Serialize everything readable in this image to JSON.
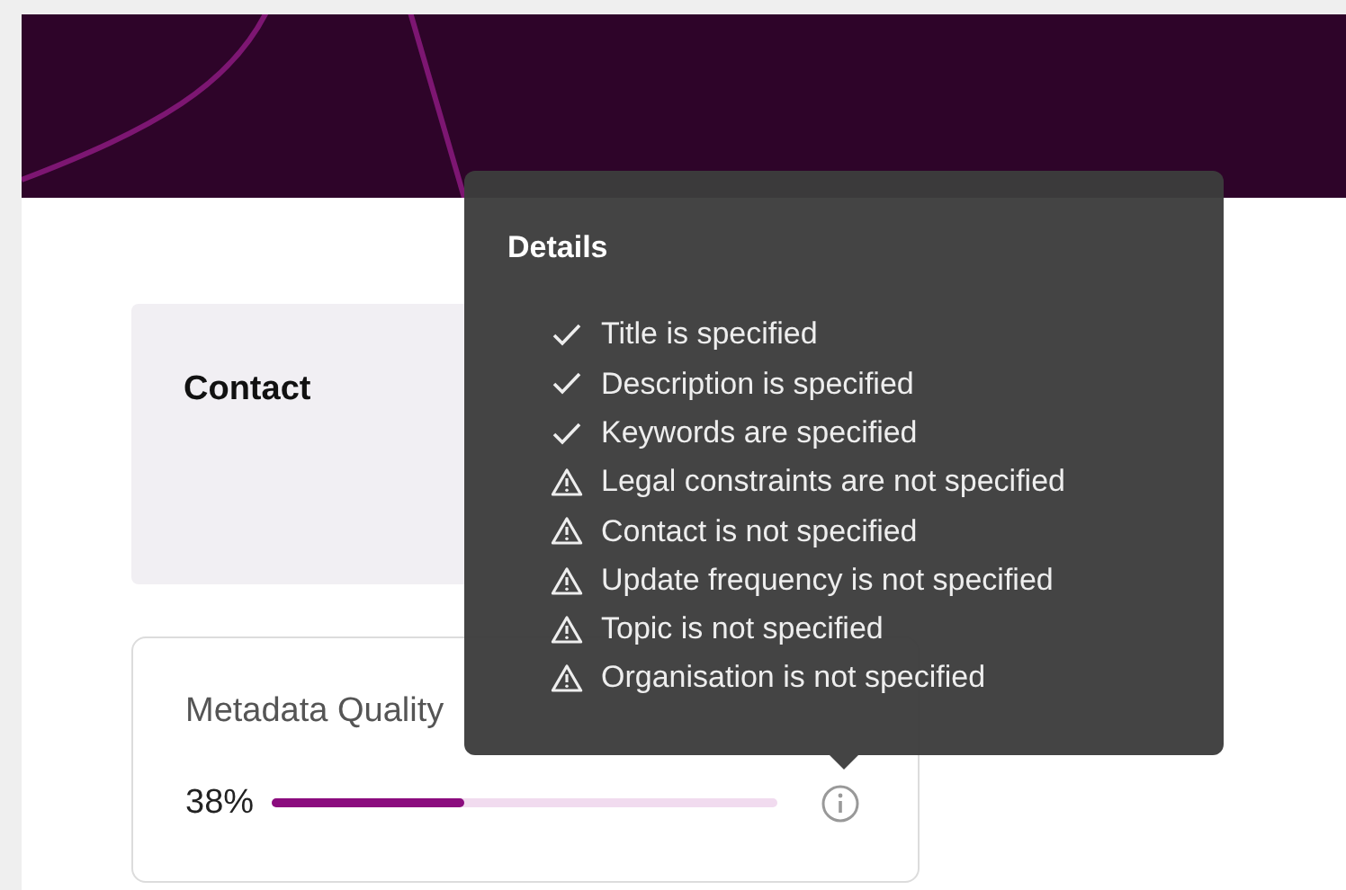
{
  "contact_card": {
    "title": "Contact"
  },
  "quality_card": {
    "title": "Metadata Quality",
    "score": "38%",
    "level": 0.38
  },
  "tooltip": {
    "title": "Details",
    "items": [
      {
        "kind": "ok",
        "text": "Title is specified"
      },
      {
        "kind": "ok",
        "text": "Description is specified"
      },
      {
        "kind": "ok",
        "text": "Keywords are specified"
      },
      {
        "kind": "warning",
        "text": "Legal constraints are not specified"
      },
      {
        "kind": "warning",
        "text": "Contact is not specified"
      },
      {
        "kind": "warning",
        "text": "Update frequency is not specified"
      },
      {
        "kind": "warning",
        "text": "Topic is not specified"
      },
      {
        "kind": "warning",
        "text": "Organisation is not specified"
      }
    ]
  }
}
